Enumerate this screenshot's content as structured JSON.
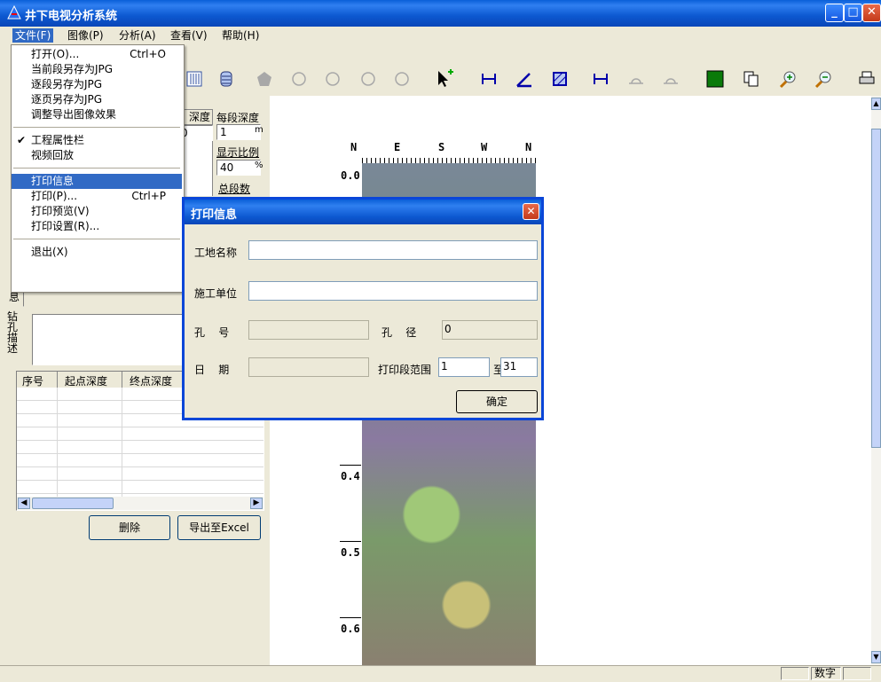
{
  "window": {
    "title": "井下电视分析系统"
  },
  "menubar": {
    "items": [
      {
        "label": "文件(F)"
      },
      {
        "label": "图像(P)"
      },
      {
        "label": "分析(A)"
      },
      {
        "label": "查看(V)"
      },
      {
        "label": "帮助(H)"
      }
    ]
  },
  "file_menu": {
    "items": [
      {
        "label": "打开(O)...",
        "shortcut": "Ctrl+O"
      },
      {
        "label": "当前段另存为JPG"
      },
      {
        "label": "逐段另存为JPG"
      },
      {
        "label": "逐页另存为JPG"
      },
      {
        "label": "调整导出图像效果"
      },
      {
        "label": "工程属性栏",
        "checked": "✔"
      },
      {
        "label": "视频回放"
      },
      {
        "label": "打印信息"
      },
      {
        "label": "打印(P)...",
        "shortcut": "Ctrl+P"
      },
      {
        "label": "打印预览(V)"
      },
      {
        "label": "打印设置(R)..."
      },
      {
        "label": "退出(X)"
      }
    ]
  },
  "left_panel": {
    "depth_header": "深度",
    "depth_value": "0",
    "segment_depth_label": "每段深度",
    "segment_depth_value": "1",
    "segment_depth_unit": "m",
    "scale_label": "显示比例",
    "scale_value": "40",
    "scale_unit": "%",
    "total_segments_label": "总段数",
    "info_label": "息",
    "hole_desc_label": "钻孔描述",
    "table_headers": [
      "序号",
      "起点深度",
      "终点深度"
    ],
    "delete_button": "删除",
    "export_button": "导出至Excel"
  },
  "compass": {
    "labels": [
      "N",
      "E",
      "S",
      "W",
      "N"
    ]
  },
  "depth_scale": [
    "0.0",
    "0.4",
    "0.5",
    "0.6"
  ],
  "dialog": {
    "title": "打印信息",
    "site_name_label": "工地名称",
    "site_name_value": "",
    "contractor_label": "施工单位",
    "contractor_value": "",
    "hole_no_label": "孔    号",
    "hole_no_value": "",
    "hole_dia_label": "孔    径",
    "hole_dia_value": "0",
    "date_label": "日    期",
    "date_value": "",
    "range_label": "打印段范围",
    "range_from": "1",
    "range_to_label": "至",
    "range_to": "31",
    "ok_button": "确定"
  },
  "statusbar": {
    "num_indicator": "数字"
  },
  "colors": {
    "titlebar": "#0a5fd8",
    "menu_highlight": "#316ac5",
    "close": "#c43a1a"
  }
}
